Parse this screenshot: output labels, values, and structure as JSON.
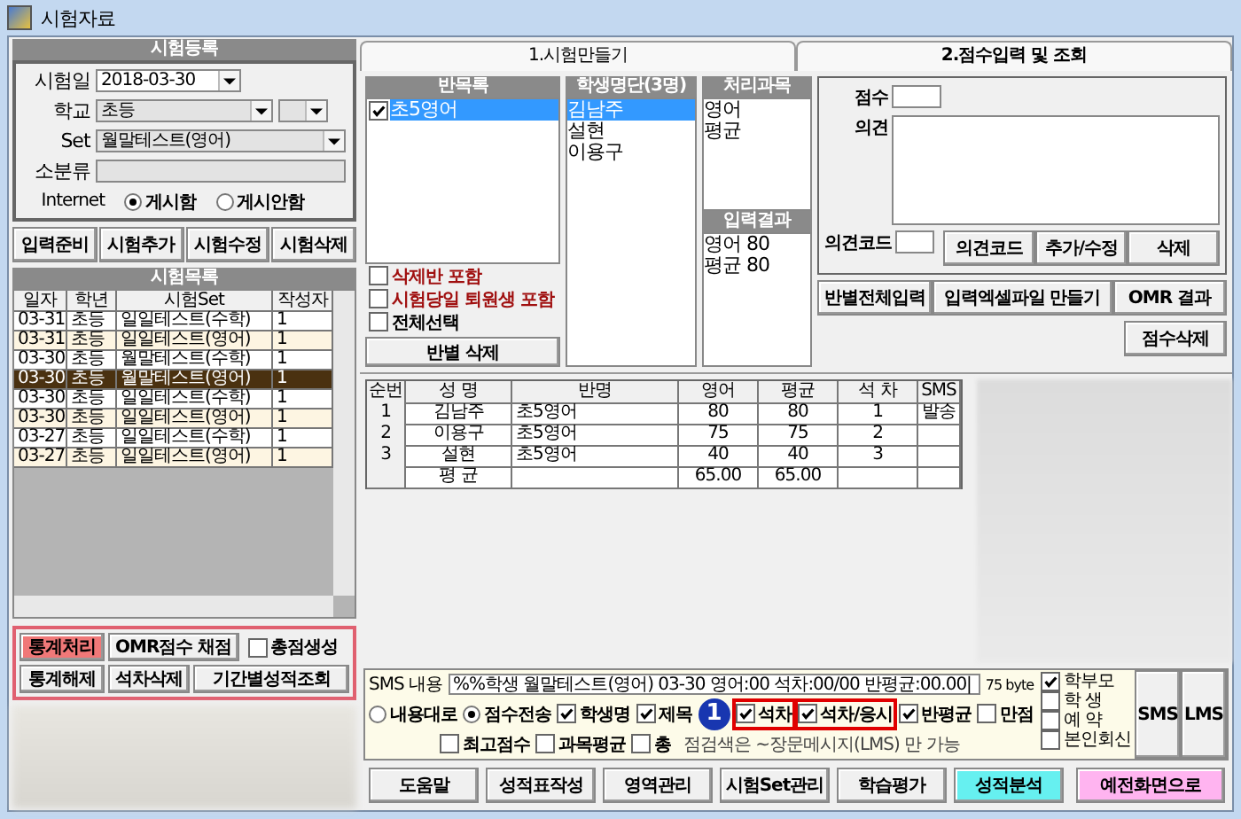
{
  "window": {
    "title": "시험자료"
  },
  "registration": {
    "header": "시험등록",
    "date_label": "시험일",
    "date": "2018-03-30",
    "school_label": "학교",
    "school": "초등",
    "set_label": "Set",
    "set": "월말테스트(영어)",
    "subcategory_label": "소분류",
    "internet_label": "Internet",
    "internet_options": [
      {
        "label": "게시함",
        "selected": true
      },
      {
        "label": "게시안함",
        "selected": false
      }
    ]
  },
  "registration_buttons": [
    "입력준비",
    "시험추가",
    "시험수정",
    "시험삭제"
  ],
  "exam_list": {
    "header": "시험목록",
    "columns": [
      "일자",
      "학년",
      "시험Set",
      "작성자"
    ],
    "rows": [
      {
        "cells": [
          "03-31",
          "초등",
          "일일테스트(수학)",
          "1"
        ],
        "selected": false
      },
      {
        "cells": [
          "03-31",
          "초등",
          "일일테스트(영어)",
          "1"
        ],
        "selected": false
      },
      {
        "cells": [
          "03-30",
          "초등",
          "월말테스트(수학)",
          "1"
        ],
        "selected": false
      },
      {
        "cells": [
          "03-30",
          "초등",
          "월말테스트(영어)",
          "1"
        ],
        "selected": true
      },
      {
        "cells": [
          "03-30",
          "초등",
          "일일테스트(수학)",
          "1"
        ],
        "selected": false
      },
      {
        "cells": [
          "03-30",
          "초등",
          "일일테스트(영어)",
          "1"
        ],
        "selected": false
      },
      {
        "cells": [
          "03-27",
          "초등",
          "일일테스트(수학)",
          "1"
        ],
        "selected": false
      },
      {
        "cells": [
          "03-27",
          "초등",
          "일일테스트(영어)",
          "1"
        ],
        "selected": false
      }
    ]
  },
  "stats_controls": [
    {
      "kind": "button",
      "label": "통계처리",
      "highlighted": true
    },
    {
      "kind": "button",
      "label": "OMR점수 채점",
      "highlighted": false
    },
    {
      "kind": "checkbox",
      "label": "총점생성",
      "checked": false
    },
    {
      "kind": "button",
      "label": "통계해제",
      "highlighted": false
    },
    {
      "kind": "button",
      "label": "석차삭제",
      "highlighted": false
    },
    {
      "kind": "button",
      "label": "기간별성적조회",
      "highlighted": false
    }
  ],
  "panel_tabs": [
    "1.시험만들기",
    "2.점수입력 및 조회"
  ],
  "class_list": {
    "header": "반목록",
    "items": [
      {
        "label": "초5영어",
        "checked": true,
        "selected": true
      }
    ],
    "options": [
      {
        "label": "삭제반 포함",
        "checked": false,
        "warning": true
      },
      {
        "label": "시험당일 퇴원생 포함",
        "checked": false,
        "warning": true
      },
      {
        "label": "전체선택",
        "checked": false,
        "warning": false
      }
    ],
    "delete_button": "반별 삭제"
  },
  "student_list": {
    "header": "학생명단(3명)",
    "items": [
      {
        "label": "김남주",
        "selected": true
      },
      {
        "label": "설현",
        "selected": false
      },
      {
        "label": "이용구",
        "selected": false
      }
    ]
  },
  "subjects": {
    "header": "처리과목",
    "items": [
      "영어",
      "평균"
    ]
  },
  "input_results": {
    "header": "입력결과",
    "items": [
      "영어 80",
      "평균 80"
    ]
  },
  "score_panel": {
    "score_label": "점수",
    "opinion_label": "의견",
    "opinion_code_label": "의견코드",
    "opinion_buttons": [
      "의견코드",
      "추가/수정",
      "삭제"
    ],
    "action_buttons": [
      "반별전체입력",
      "입력엑셀파일 만들기",
      "OMR 결과"
    ],
    "delete_button": "점수삭제"
  },
  "results_table": {
    "columns": [
      "순번",
      "성 명",
      "반명",
      "영어",
      "평균",
      "석 차",
      "SMS"
    ],
    "rows": [
      [
        "1",
        "김남주",
        "초5영어",
        "80",
        "80",
        "1",
        "발송"
      ],
      [
        "2",
        "이용구",
        "초5영어",
        "75",
        "75",
        "2",
        ""
      ],
      [
        "3",
        "설현",
        "초5영어",
        "40",
        "40",
        "3",
        ""
      ]
    ],
    "average_row": {
      "label": "평 균",
      "values": [
        "65.00",
        "65.00"
      ]
    }
  },
  "sms": {
    "label": "SMS 내용",
    "value": "%%학생 월말테스트(영어) 03-30 영어:00 석차:00/00 반평균:00.00|",
    "bytes": "75 byte",
    "modes": [
      {
        "label": "내용대로",
        "selected": false
      },
      {
        "label": "점수전송",
        "selected": true
      }
    ],
    "fields_row1": [
      {
        "label": "학생명",
        "checked": true,
        "boxed": false
      },
      {
        "label": "제목",
        "checked": true,
        "boxed": false
      },
      {
        "label": "석차",
        "checked": true,
        "boxed": true
      },
      {
        "label": "석차/응시",
        "checked": true,
        "boxed": true
      },
      {
        "label": "반평균",
        "checked": true,
        "boxed": false
      },
      {
        "label": "만점",
        "checked": false,
        "boxed": false
      }
    ],
    "fields_row2": [
      {
        "label": "최고점수",
        "checked": false
      },
      {
        "label": "과목평균",
        "checked": false
      },
      {
        "label": "총",
        "checked": false
      }
    ],
    "note": "점검색은 ~장문메시지(LMS) 만 가능",
    "recipients": [
      {
        "label": "학부모",
        "checked": true
      },
      {
        "label": "학 생",
        "checked": false
      },
      {
        "label": "예 약",
        "checked": false
      },
      {
        "label": "본인회신",
        "checked": false
      }
    ],
    "send_buttons": [
      "SMS",
      "LMS"
    ],
    "callout": "1"
  },
  "bottom_buttons": [
    {
      "label": "도움말",
      "color": "#f0f0f0"
    },
    {
      "label": "성적표작성",
      "color": "#f0f0f0"
    },
    {
      "label": "영역관리",
      "color": "#f0f0f0"
    },
    {
      "label": "시험Set관리",
      "color": "#f0f0f0"
    },
    {
      "label": "학습평가",
      "color": "#f0f0f0"
    },
    {
      "label": "성적분석",
      "color": "#66f0f0"
    }
  ],
  "back_button": {
    "label": "예전화면으로",
    "color": "#ffb4f0"
  }
}
